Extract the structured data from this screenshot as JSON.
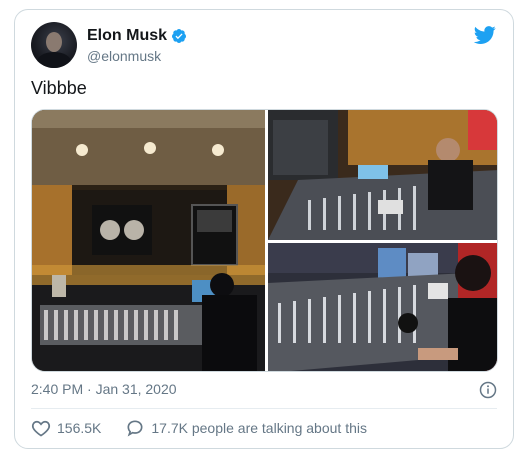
{
  "user": {
    "display_name": "Elon Musk",
    "handle": "@elonmusk"
  },
  "tweet": {
    "text": "Vibbbe",
    "timestamp": "2:40 PM · Jan 31, 2020"
  },
  "engagement": {
    "likes": "156.5K",
    "talking": "17.7K people are talking about this"
  },
  "icons": {
    "brand": "twitter-bird-icon",
    "verified": "verified-badge-icon",
    "info": "info-icon",
    "like": "heart-icon",
    "reply": "comment-icon"
  },
  "colors": {
    "brand": "#1da1f2",
    "secondary_text": "#657786",
    "border": "#cfd9de"
  }
}
